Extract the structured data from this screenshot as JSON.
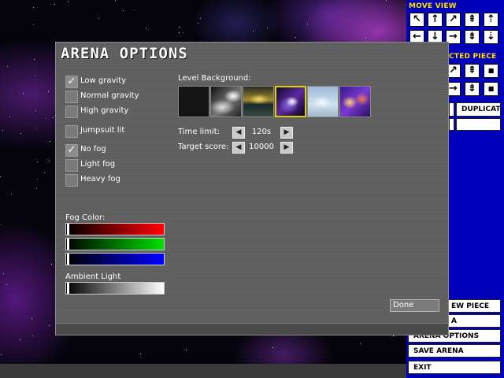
{
  "dialog": {
    "title": "ARENA OPTIONS",
    "options": [
      {
        "label": "Low gravity",
        "checked": true
      },
      {
        "label": "Normal gravity",
        "checked": false
      },
      {
        "label": "High gravity",
        "checked": false
      },
      {
        "label": "Jumpsuit lit",
        "checked": false
      },
      {
        "label": "No fog",
        "checked": true
      },
      {
        "label": "Light fog",
        "checked": false
      },
      {
        "label": "Heavy fog",
        "checked": false
      }
    ],
    "check_glyph": "✓",
    "level_background_label": "Level Background:",
    "backgrounds": [
      {
        "name": "black",
        "selected": false
      },
      {
        "name": "grey-clouds",
        "selected": false
      },
      {
        "name": "golden-horizon",
        "selected": false
      },
      {
        "name": "purple-nebula",
        "selected": true
      },
      {
        "name": "sky-clouds",
        "selected": false
      },
      {
        "name": "fire-nebula",
        "selected": false
      }
    ],
    "time_limit": {
      "label": "Time limit:",
      "value": "120s"
    },
    "target_score": {
      "label": "Target score:",
      "value": "10000"
    },
    "fog_color_label": "Fog Color:",
    "fog_color": {
      "red": 0,
      "green": 0,
      "blue": 0
    },
    "ambient_light_label": "Ambient Light",
    "ambient_light": 0,
    "done_label": "Done",
    "colors": {
      "red": "#ff0000",
      "green": "#00ff00",
      "blue": "#0000ff",
      "selected_border": "#e0d000"
    }
  },
  "right_panel": {
    "move_view_label": "MOVE VIEW",
    "move_view_buttons_row1": [
      "↖",
      "↑",
      "↗",
      "⇞",
      "⇡"
    ],
    "move_view_buttons_row2": [
      "←",
      "↓",
      "→",
      "⇟",
      "⇣"
    ],
    "selected_piece_label": "CTED PIECE",
    "selected_piece_buttons_row1": [
      "↗",
      "⇞",
      "■"
    ],
    "selected_piece_buttons_row2": [
      "→",
      "⇟",
      "■"
    ],
    "duplicate_label": "DUPLICATE",
    "menu_new_piece": "EW PIECE",
    "menu_arena": "A",
    "menu_arena_options": "ARENA OPTIONS",
    "menu_save_arena": "SAVE ARENA",
    "menu_exit": "EXIT",
    "panel_color": "#0000b8",
    "header_color": "#ffe000"
  }
}
